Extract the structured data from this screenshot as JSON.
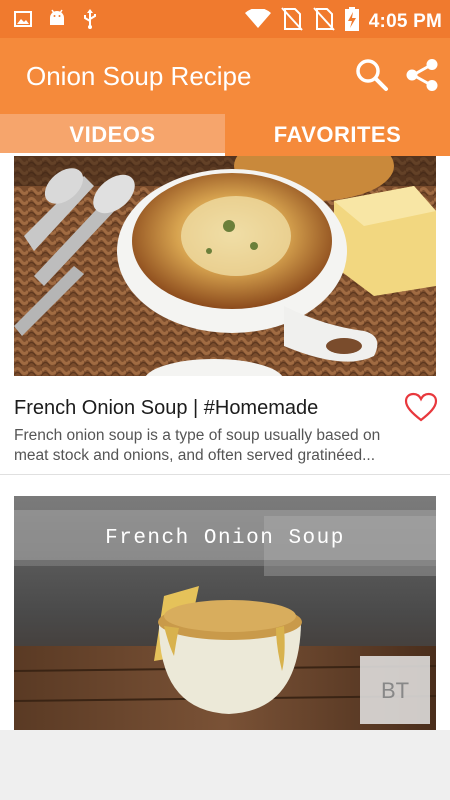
{
  "status_bar": {
    "time": "4:05 PM",
    "icons": [
      "image-icon",
      "android-icon",
      "usb-icon",
      "wifi-icon",
      "no-sim-icon",
      "no-sim-icon",
      "battery-charging-icon"
    ]
  },
  "app_bar": {
    "title": "Onion Soup Recipe",
    "actions": [
      "search-icon",
      "share-icon"
    ]
  },
  "tabs": [
    {
      "label": "VIDEOS",
      "selected": true
    },
    {
      "label": "FAVORITES",
      "selected": false
    }
  ],
  "videos": [
    {
      "title": "French Onion Soup | #Homemade",
      "description_line1": "French onion soup  is a type of soup usually based on",
      "description_line2": "meat stock and onions, and often served gratinéed...",
      "favorite": false
    },
    {
      "thumbnail_text": "French Onion Soup",
      "watermark": "BT"
    }
  ],
  "colors": {
    "status_bar": "#f07a2e",
    "app_bar": "#f58a3b",
    "tab_unselected": "#f6a56c",
    "heart": "#e8383d"
  }
}
